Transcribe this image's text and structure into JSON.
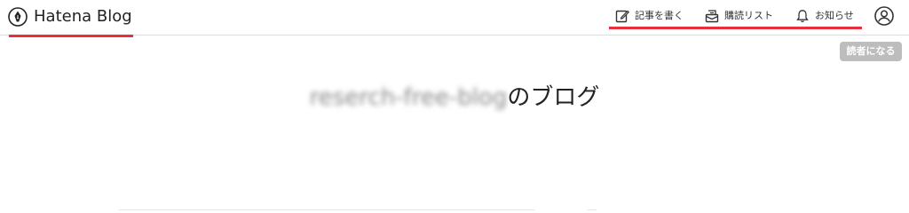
{
  "header": {
    "logo_text": "Hatena Blog",
    "nav": [
      {
        "label": "記事を書く",
        "icon": "edit-icon"
      },
      {
        "label": "購読リスト",
        "icon": "subscription-list-icon"
      },
      {
        "label": "お知らせ",
        "icon": "bell-icon"
      }
    ],
    "avatar_icon": "user-avatar-icon",
    "highlight_color": "#e8303c"
  },
  "subscribe_button": {
    "label": "読者になる",
    "color": "#bdbdbd"
  },
  "blog": {
    "name": "reserch-free-blog",
    "title_suffix": "のブログ"
  }
}
